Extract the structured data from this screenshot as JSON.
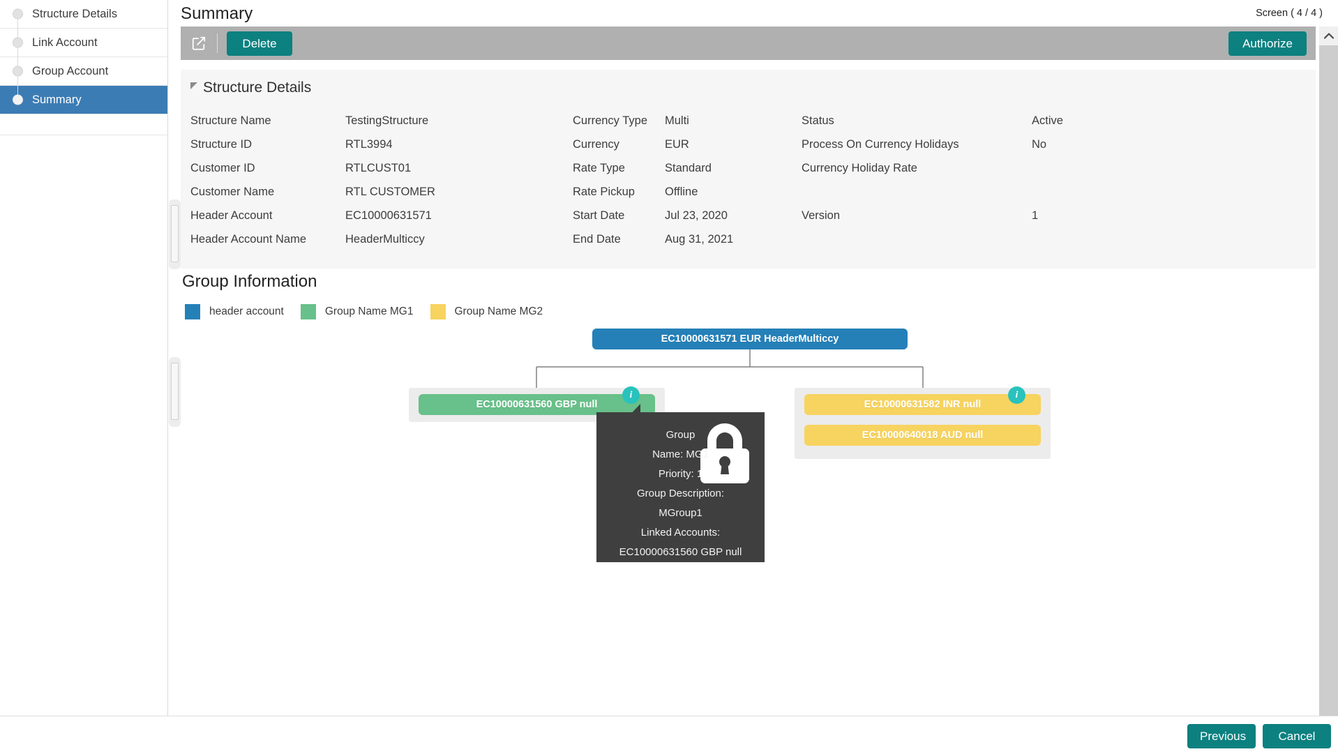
{
  "header": {
    "title": "Summary",
    "screen_counter": "Screen ( 4 / 4 )"
  },
  "sidebar": {
    "items": [
      {
        "label": "Structure Details",
        "active": false
      },
      {
        "label": "Link Account",
        "active": false
      },
      {
        "label": "Group Account",
        "active": false
      },
      {
        "label": "Summary",
        "active": true
      }
    ]
  },
  "toolbar": {
    "edit_icon": "edit-square-icon",
    "delete_label": "Delete",
    "authorize_label": "Authorize"
  },
  "details": {
    "section_title": "Structure Details",
    "column1": [
      {
        "label": "Structure Name",
        "value": "TestingStructure"
      },
      {
        "label": "Structure ID",
        "value": "RTL3994"
      },
      {
        "label": "Customer ID",
        "value": "RTLCUST01"
      },
      {
        "label": "Customer Name",
        "value": "RTL CUSTOMER"
      },
      {
        "label": "Header Account",
        "value": "EC10000631571"
      },
      {
        "label": "Header Account Name",
        "value": "HeaderMulticcy"
      }
    ],
    "column2": [
      {
        "label": "Currency Type",
        "value": "Multi"
      },
      {
        "label": "Currency",
        "value": "EUR"
      },
      {
        "label": "Rate Type",
        "value": "Standard"
      },
      {
        "label": "Rate Pickup",
        "value": "Offline"
      },
      {
        "label": "Start Date",
        "value": "Jul 23, 2020"
      },
      {
        "label": "End Date",
        "value": "Aug 31, 2021"
      }
    ],
    "column3": [
      {
        "label": "Status",
        "value": "Active"
      },
      {
        "label": "Process On Currency Holidays",
        "value": "No"
      },
      {
        "label": "Currency Holiday Rate",
        "value": ""
      },
      {
        "label": "Version",
        "value": "1"
      }
    ]
  },
  "group_information": {
    "title": "Group Information",
    "legend": [
      {
        "label": "header account",
        "color": "#2580b8"
      },
      {
        "label": "Group Name MG1",
        "color": "#68c08a"
      },
      {
        "label": "Group Name MG2",
        "color": "#f7d35f"
      }
    ],
    "tree": {
      "root": {
        "label": "EC10000631571 EUR HeaderMulticcy",
        "color": "#2580b8"
      },
      "left_group": {
        "badge": "i",
        "nodes": [
          {
            "label": "EC10000631560 GBP null",
            "color": "#68c08a"
          }
        ]
      },
      "right_group": {
        "badge": "i",
        "nodes": [
          {
            "label": "EC10000631582 INR null",
            "color": "#f7d35f"
          },
          {
            "label": "EC10000640018 AUD null",
            "color": "#f7d35f"
          }
        ]
      }
    },
    "tooltip": {
      "icon": "lock-icon",
      "lines": [
        "Group",
        "Name: MG1",
        "Priority: 1",
        "Group Description:",
        "MGroup1",
        "Linked Accounts:",
        "EC10000631560 GBP null"
      ]
    }
  },
  "footer": {
    "previous_label": "Previous",
    "cancel_label": "Cancel"
  },
  "colors": {
    "accent_teal": "#0d8080",
    "active_nav": "#3c7cb4",
    "toolbar_gray": "#b0b0b0",
    "badge_teal": "#29c2bd",
    "tooltip_bg": "#3f3f3f"
  }
}
